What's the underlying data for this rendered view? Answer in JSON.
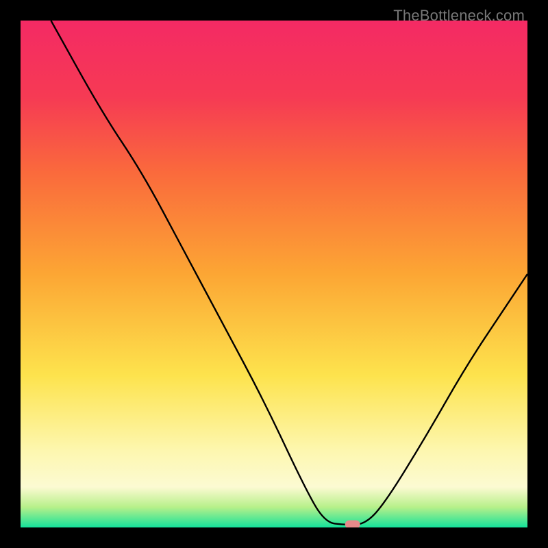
{
  "watermark": "TheBottleneck.com",
  "chart_data": {
    "type": "line",
    "title": "",
    "xlabel": "",
    "ylabel": "",
    "xlim": [
      0,
      100
    ],
    "ylim": [
      0,
      100
    ],
    "watermark": "TheBottleneck.com",
    "background_gradient_heatmap": {
      "description": "Vertical gradient from green at bottom through yellow/orange to red/magenta at top, representing bottleneck severity",
      "stops": [
        {
          "t": 0.0,
          "color": "#14e29a"
        },
        {
          "t": 0.04,
          "color": "#b7f08a"
        },
        {
          "t": 0.08,
          "color": "#fcfad2"
        },
        {
          "t": 0.15,
          "color": "#fdf7b0"
        },
        {
          "t": 0.3,
          "color": "#fde34d"
        },
        {
          "t": 0.5,
          "color": "#fca634"
        },
        {
          "t": 0.7,
          "color": "#fa6a3c"
        },
        {
          "t": 0.85,
          "color": "#f63a54"
        },
        {
          "t": 1.0,
          "color": "#f42a64"
        }
      ]
    },
    "curve": {
      "description": "V-shaped bottleneck curve; minimum at ~x=64 near y=0",
      "points": [
        {
          "x": 6,
          "y": 100
        },
        {
          "x": 16,
          "y": 82
        },
        {
          "x": 24,
          "y": 70
        },
        {
          "x": 32,
          "y": 55
        },
        {
          "x": 40,
          "y": 40
        },
        {
          "x": 48,
          "y": 25
        },
        {
          "x": 56,
          "y": 8
        },
        {
          "x": 60,
          "y": 1
        },
        {
          "x": 64,
          "y": 0.5
        },
        {
          "x": 68,
          "y": 0.6
        },
        {
          "x": 72,
          "y": 5
        },
        {
          "x": 80,
          "y": 18
        },
        {
          "x": 88,
          "y": 32
        },
        {
          "x": 96,
          "y": 44
        },
        {
          "x": 100,
          "y": 50
        }
      ]
    },
    "marker": {
      "x": 65.5,
      "y": 0.6,
      "color": "#e78a8a",
      "shape": "rounded-rect"
    }
  }
}
